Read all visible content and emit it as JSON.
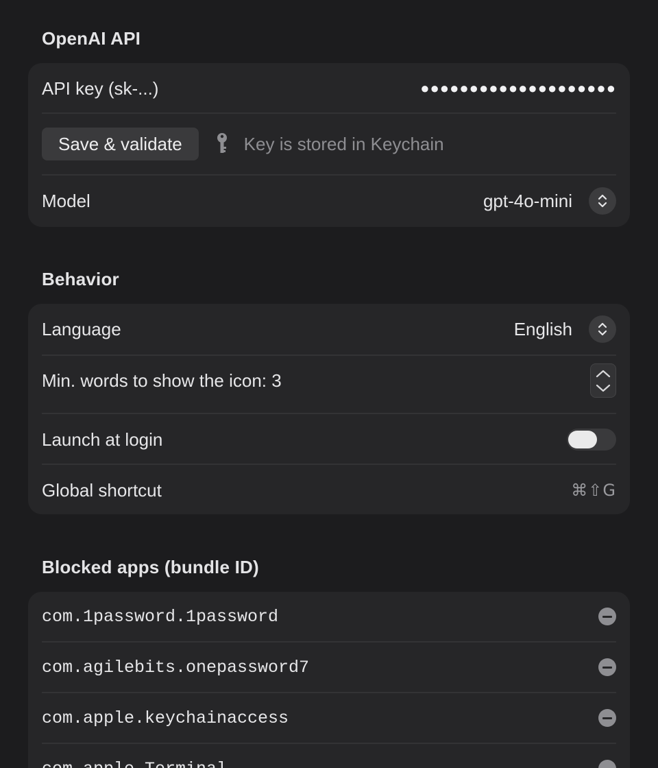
{
  "openai_section": {
    "title": "OpenAI API",
    "api_key_label": "API key (sk-...)",
    "api_key_value": "●●●●●●●●●●●●●●●●●●●●",
    "save_label": "Save & validate",
    "key_icon": "key-icon",
    "keychain_hint": "Key is stored in Keychain",
    "model_label": "Model",
    "model_value": "gpt-4o-mini"
  },
  "behavior_section": {
    "title": "Behavior",
    "language_label": "Language",
    "language_value": "English",
    "min_words_label": "Min. words to show the icon: 3",
    "launch_label": "Launch at login",
    "launch_enabled": false,
    "shortcut_label": "Global shortcut",
    "shortcut_value": "⌘⇧G"
  },
  "blocked_section": {
    "title": "Blocked apps (bundle ID)",
    "apps": [
      "com.1password.1password",
      "com.agilebits.onepassword7",
      "com.apple.keychainaccess",
      "com.apple.Terminal"
    ]
  },
  "colors": {
    "background": "#1c1c1e",
    "card": "#262628",
    "secondary_text": "#8e8e92"
  }
}
